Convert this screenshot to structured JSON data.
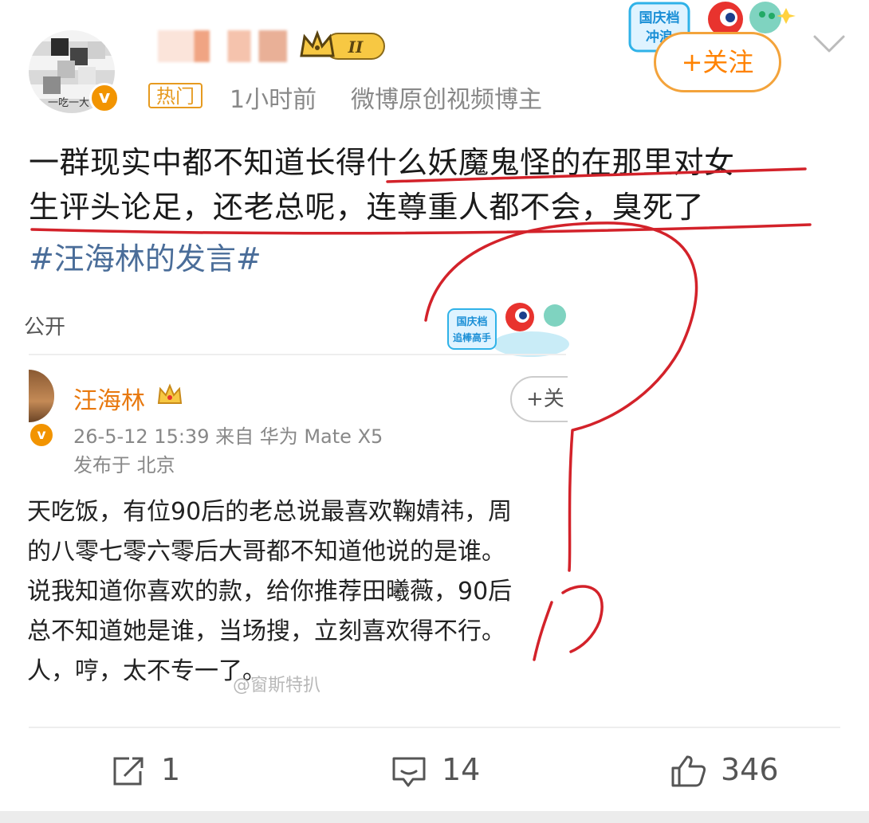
{
  "post": {
    "avatar_caption": "一吃一大",
    "verified_mark": "v",
    "level_badge": "II",
    "hot_tag": "热门",
    "time": "1小时前",
    "source": "微博原创视频博主",
    "follow_label": "+关注",
    "promo_sticker_text": "国庆档 冲浪",
    "text_line1": "一群现实中都不知道长得什么妖魔鬼怪的在那里对女",
    "text_line2": "生评头论足，还老总呢，连尊重人都不会，臭死了",
    "hashtag": "#汪海林的发言#"
  },
  "embed": {
    "visibility": "公开",
    "sticker_text": "国庆档 追棒高手",
    "author": "汪海林",
    "follow_label": "+关",
    "meta": "26-5-12 15:39   来自 华为 Mate X5",
    "location": "发布于 北京",
    "body_lines": [
      "天吃饭，有位90后的老总说最喜欢鞠婧祎，周",
      "的八零七零六零后大哥都不知道他说的是谁。",
      "说我知道你喜欢的款，给你推荐田曦薇，90后",
      "总不知道她是谁，当场搜，立刻喜欢得不行。",
      "人，哼，太不专一了。"
    ],
    "watermark": "@窗斯特扒"
  },
  "actions": {
    "repost_count": "1",
    "comment_count": "14",
    "like_count": "346"
  },
  "colors": {
    "accent_orange": "#ff8200",
    "hashtag_blue": "#4a6d99",
    "ink_red": "#d3222a"
  }
}
